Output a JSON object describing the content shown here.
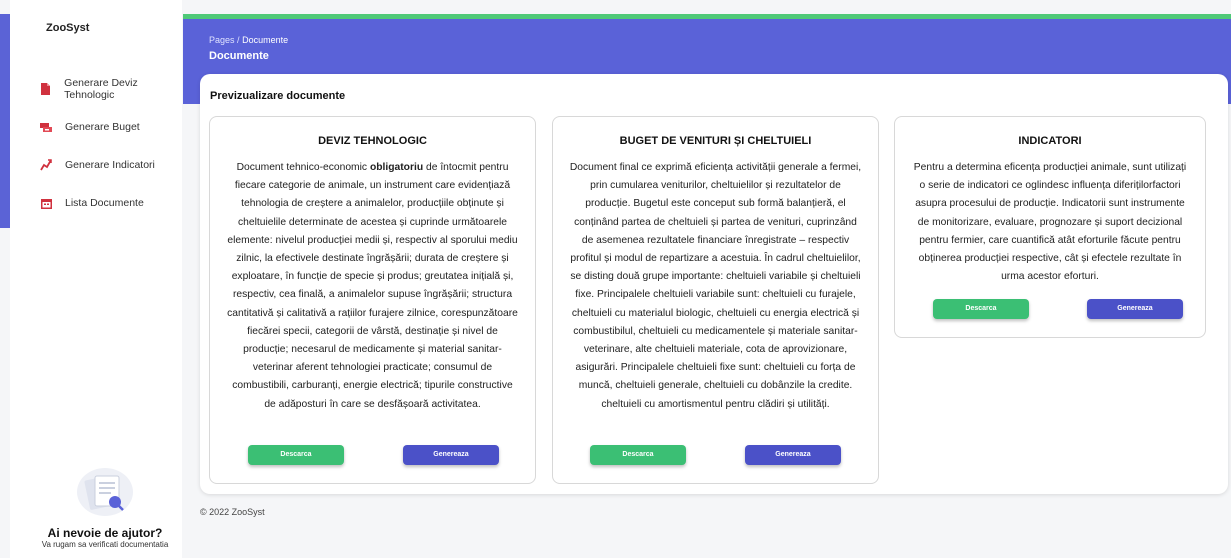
{
  "app": {
    "brand": "ZooSyst"
  },
  "sidebar": {
    "items": [
      {
        "label": "Generare Deviz Tehnologic",
        "icon": "file-icon",
        "color": "#d0313e"
      },
      {
        "label": "Generare Buget",
        "icon": "wallet-icon",
        "color": "#d0313e"
      },
      {
        "label": "Generare Indicatori",
        "icon": "chart-icon",
        "color": "#d0313e"
      },
      {
        "label": "Lista Documente",
        "icon": "calendar-icon",
        "color": "#d0313e"
      }
    ],
    "help": {
      "title": "Ai nevoie de ajutor?",
      "subtitle": "Va rugam sa verificati documentatia"
    }
  },
  "header": {
    "breadcrumb_parent": "Pages",
    "breadcrumb_sep": "/",
    "breadcrumb_current": "Documente",
    "title": "Documente"
  },
  "main": {
    "panel_title": "Previzualizare documente",
    "cards": [
      {
        "title": "DEVIZ TEHNOLOGIC",
        "text_before": "Document tehnico-economic ",
        "text_bold": "obligatoriu",
        "text_after": " de întocmit pentru fiecare categorie de animale, un instrument care evidențiază tehnologia de creștere a animalelor, producțiile obținute și cheltuielile determinate de acestea și cuprinde următoarele elemente: nivelul producției medii și, respectiv al sporului mediu zilnic, la efectivele destinate îngrășării; durata de creștere și exploatare, în funcție de specie și produs; greutatea inițială și, respectiv, cea finală, a animalelor supuse îngrășării; structura cantitativă și calitativă a rațiilor furajere zilnice, corespunzătoare fiecărei specii, categorii de vârstă, destinație și nivel de producție; necesarul de medicamente și material sanitar-veterinar aferent tehnologiei practicate; consumul de combustibili, carburanți, energie electrică; tipurile constructive de adăposturi în care se desfășoară activitatea.",
        "download_label": "Descarca",
        "generate_label": "Genereaza"
      },
      {
        "title": "BUGET DE VENITURI ȘI CHELTUIELI",
        "text": "Document final ce exprimă eficiența activității generale a fermei, prin cumularea veniturilor, cheltuielilor și rezultatelor de producție. Bugetul este conceput sub formă balanțieră, el conținând partea de cheltuieli și partea de venituri, cuprinzând de asemenea rezultatele financiare înregistrate – respectiv profitul și modul de repartizare a acestuia. În cadrul cheltuielilor, se disting două grupe importante: cheltuieli variabile și cheltuieli fixe. Principalele cheltuieli variabile sunt: cheltuieli cu furajele, cheltuieli cu materialul biologic, cheltuieli cu energia electrică și combustibilul, cheltuieli cu medicamentele și materiale sanitar-veterinare, alte cheltuieli materiale, cota de aprovizionare, asigurări. Principalele cheltuieli fixe sunt: cheltuieli cu forța de muncă, cheltuieli generale, cheltuieli cu dobânzile la credite. cheltuieli cu amortismentul pentru clădiri și utilități.",
        "download_label": "Descarca",
        "generate_label": "Genereaza"
      },
      {
        "title": "INDICATORI",
        "text": "Pentru a determina eficența producției animale, sunt utilizați o serie de indicatori ce oglindesc influența diferițilorfactori asupra procesului de producție. Indicatorii sunt instrumente de monitorizare, evaluare, prognozare și suport decizional pentru fermier, care cuantifică atât eforturile făcute pentru obținerea producției respective, cât și efectele rezultate în urma acestor eforturi.",
        "download_label": "Descarca",
        "generate_label": "Genereaza"
      }
    ]
  },
  "footer": {
    "copyright": "© 2022 ZooSyst"
  },
  "colors": {
    "accent": "#5a62d8",
    "success": "#3bbf74",
    "top_line": "#4fc978"
  }
}
